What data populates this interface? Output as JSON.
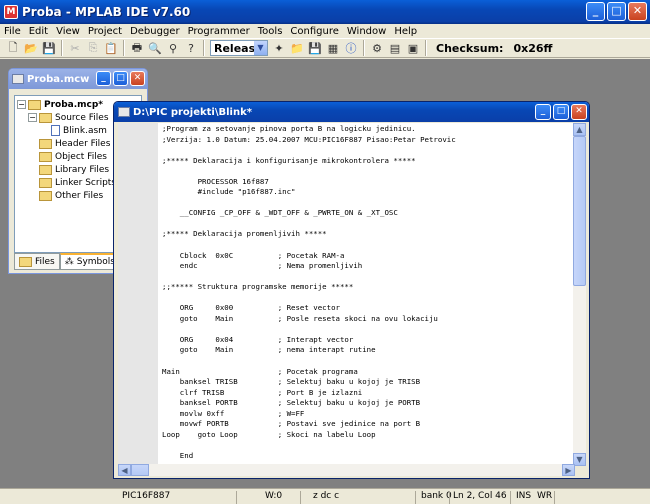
{
  "app": {
    "title": "Proba - MPLAB IDE v7.60",
    "icon": "mplab-app-icon"
  },
  "menu": [
    "File",
    "Edit",
    "View",
    "Project",
    "Debugger",
    "Programmer",
    "Tools",
    "Configure",
    "Window",
    "Help"
  ],
  "toolbar": {
    "build_config": "Release",
    "checksum_label": "Checksum:",
    "checksum_value": "0x26ff"
  },
  "workspace_window": {
    "title": "Proba.mcw",
    "tree": [
      {
        "label": "Proba.mcp*",
        "level": 0,
        "kind": "project",
        "expander": "−"
      },
      {
        "label": "Source Files",
        "level": 1,
        "kind": "folder",
        "expander": "−"
      },
      {
        "label": "Blink.asm",
        "level": 2,
        "kind": "file",
        "expander": ""
      },
      {
        "label": "Header Files",
        "level": 1,
        "kind": "folder",
        "expander": ""
      },
      {
        "label": "Object Files",
        "level": 1,
        "kind": "folder",
        "expander": ""
      },
      {
        "label": "Library Files",
        "level": 1,
        "kind": "folder",
        "expander": ""
      },
      {
        "label": "Linker Scripts",
        "level": 1,
        "kind": "folder",
        "expander": ""
      },
      {
        "label": "Other Files",
        "level": 1,
        "kind": "folder",
        "expander": ""
      }
    ],
    "tabs": [
      "Files",
      "Symbols"
    ]
  },
  "editor": {
    "title": "D:\\PIC projekti\\Blink*",
    "lines": [
      ";Program za setovanje pinova porta B na logicku jedinicu.",
      ";Verzija: 1.0 Datum: 25.04.2007 MCU:PIC16F887 Pisao:Petar Petrovic",
      "",
      ";***** Deklaracija i konfigurisanje mikrokontrolera *****",
      "",
      "        PROCESSOR 16f887",
      "        #include \"p16f887.inc\"",
      "",
      "    __CONFIG _CP_OFF & _WDT_OFF & _PWRTE_ON & _XT_OSC",
      "",
      ";***** Deklaracija promenljivih *****",
      "",
      "    Cblock  0x0C          ; Pocetak RAM-a",
      "    endc                  ; Nema promenljivih",
      "",
      ";;***** Struktura programske memorije *****",
      "",
      "    ORG     0x00          ; Reset vector",
      "    goto    Main          ; Posle reseta skoci na ovu lokaciju",
      "",
      "    ORG     0x04          ; Interapt vector",
      "    goto    Main          ; nema interapt rutine",
      "",
      "Main                      ; Pocetak programa",
      "    banksel TRISB         ; Selektuj baku u kojoj je TRISB",
      "    clrf TRISB            ; Port B je izlazni",
      "    banksel PORTB         ; Selektuj baku u kojoj je PORTB",
      "    movlw 0xff            ; W=FF",
      "    movwf PORTB           ; Postavi sve jedinice na port B",
      "Loop    goto Loop         ; Skoci na labelu Loop",
      "",
      "    End"
    ]
  },
  "statusbar": {
    "device": "PIC16F887",
    "w_reg": "W:0",
    "flags": "z dc c",
    "bank": "bank 0",
    "position": "Ln 2, Col 46",
    "ins": "INS",
    "wr": "WR"
  }
}
